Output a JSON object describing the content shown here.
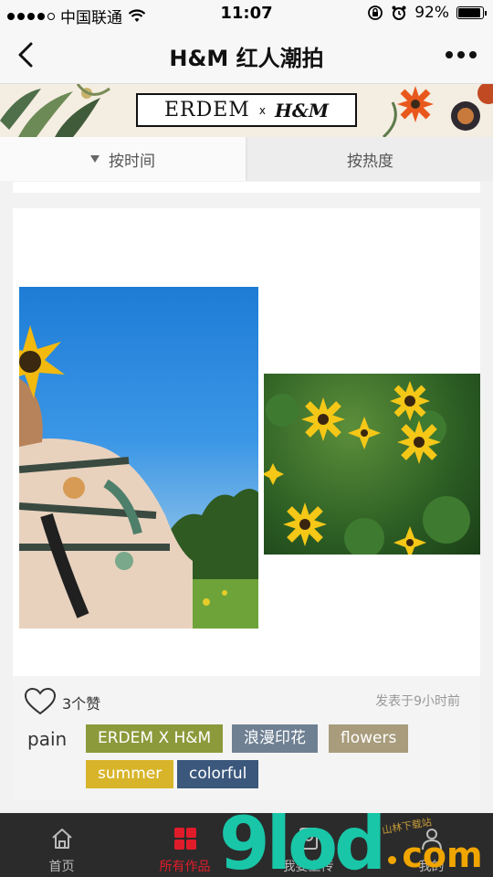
{
  "status_bar": {
    "carrier": "中国联通",
    "time": "11:07",
    "battery": "92%",
    "battery_level": 0.92,
    "signal_bars": 4
  },
  "nav": {
    "title": "H&M 红人潮拍"
  },
  "banner": {
    "brand_left": "ERDEM",
    "x": "x",
    "brand_right": "H&M"
  },
  "tabs": [
    {
      "label": "按时间",
      "active": true
    },
    {
      "label": "按热度",
      "active": false
    }
  ],
  "post": {
    "likes": "3个赞",
    "posted": "发表于9小时前",
    "author": "pain",
    "tags": [
      {
        "label": "ERDEM X H&M",
        "color": "#8c9a3b"
      },
      {
        "label": "浪漫印花",
        "color": "#6f8093"
      },
      {
        "label": "flowers",
        "color": "#a89c7c"
      },
      {
        "label": "summer",
        "color": "#d8b42a"
      },
      {
        "label": "colorful",
        "color": "#3b577c"
      }
    ]
  },
  "tabbar": [
    {
      "label": "首页",
      "icon": "home-icon",
      "active": false
    },
    {
      "label": "所有作品",
      "icon": "grid-icon",
      "active": true
    },
    {
      "label": "我要上传",
      "icon": "upload-icon",
      "active": false
    },
    {
      "label": "我的",
      "icon": "person-icon",
      "active": false
    }
  ],
  "colors": {
    "accent": "#e11c2a",
    "tabbar_bg": "#2b2b2b"
  },
  "watermark": {
    "brand": "9lod",
    "suffix": "com",
    "site": "山林下载站"
  }
}
